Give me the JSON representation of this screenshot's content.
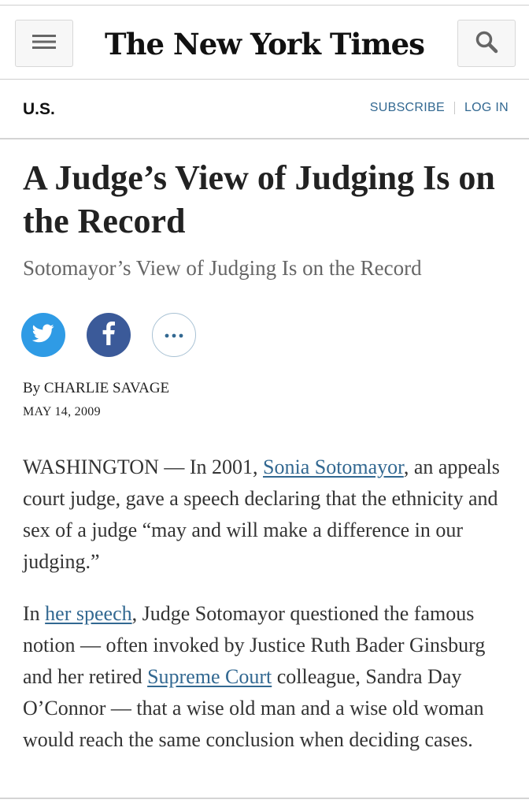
{
  "masthead": {
    "logo_text": "The New York Times",
    "menu_icon": "hamburger-menu-icon",
    "search_icon": "search-icon"
  },
  "section_bar": {
    "section": "U.S.",
    "subscribe": "SUBSCRIBE",
    "login": "LOG IN"
  },
  "article": {
    "headline": "A Judge’s View of Judging Is on the Record",
    "subheadline": "Sotomayor’s View of Judging Is on the Record",
    "byline": "By CHARLIE SAVAGE",
    "date": "MAY 14, 2009",
    "share": {
      "twitter_icon": "twitter-icon",
      "facebook_icon": "facebook-icon",
      "more_icon": "more-options-icon"
    },
    "paragraphs": [
      {
        "before_link": "WASHINGTON — In 2001, ",
        "link_text": "Sonia Sotomayor",
        "after_link": ", an appeals court judge, gave a speech declaring that the ethnicity and sex of a judge “may and will make a difference in our judging.”"
      },
      {
        "intro": "In ",
        "link1_text": "her speech",
        "middle": ", Judge Sotomayor questioned the famous notion — often invoked by Justice Ruth Bader Ginsburg and her retired ",
        "link2_text": "Supreme Court",
        "end": " colleague, Sandra Day O’Connor — that a wise old man and a wise old woman would reach the same conclusion when deciding cases."
      }
    ]
  },
  "colors": {
    "link": "#326891",
    "twitter": "#2f9be5",
    "facebook": "#3b5a99"
  }
}
